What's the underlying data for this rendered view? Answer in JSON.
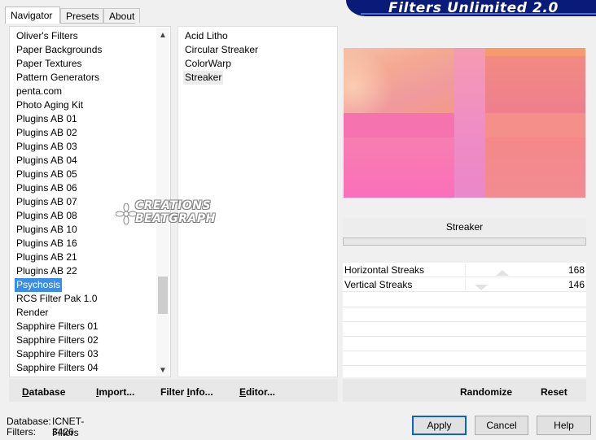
{
  "app": {
    "title": "Filters Unlimited 2.0"
  },
  "tabs": [
    {
      "label": "Navigator",
      "active": true
    },
    {
      "label": "Presets",
      "active": false
    },
    {
      "label": "About",
      "active": false
    }
  ],
  "categories": {
    "items": [
      "Oliver's Filters",
      "Paper Backgrounds",
      "Paper Textures",
      "Pattern Generators",
      "penta.com",
      "Photo Aging Kit",
      "Plugins AB 01",
      "Plugins AB 02",
      "Plugins AB 03",
      "Plugins AB 04",
      "Plugins AB 05",
      "Plugins AB 06",
      "Plugins AB 07",
      "Plugins AB 08",
      "Plugins AB 10",
      "Plugins AB 16",
      "Plugins AB 21",
      "Plugins AB 22",
      "Psychosis",
      "RCS Filter Pak 1.0",
      "Render",
      "Sapphire Filters 01",
      "Sapphire Filters 02",
      "Sapphire Filters 03",
      "Sapphire Filters 04"
    ],
    "selected": "Psychosis"
  },
  "filters": {
    "items": [
      "Acid Litho",
      "Circular Streaker",
      "ColorWarp",
      "Streaker"
    ],
    "selected": "Streaker"
  },
  "preview": {
    "filter_name": "Streaker"
  },
  "parameters": [
    {
      "label": "Horizontal Streaks",
      "value": "168"
    },
    {
      "label": "Vertical Streaks",
      "value": "146"
    }
  ],
  "toolbar": {
    "database": {
      "hot": "D",
      "rest": "atabase"
    },
    "import": {
      "hot": "I",
      "rest": "mport..."
    },
    "filter_info": {
      "pre": "Filter ",
      "hot": "I",
      "rest": "nfo..."
    },
    "editor": {
      "hot": "E",
      "rest": "ditor..."
    },
    "randomize": "Randomize",
    "reset": "Reset"
  },
  "status": {
    "database_label": "Database:",
    "database_value": "ICNET-Filters",
    "filters_label": "Filters:",
    "filters_value": "3426"
  },
  "buttons": {
    "apply": "Apply",
    "cancel": "Cancel",
    "help": "Help"
  },
  "watermark": {
    "line1": "CREATIONS",
    "line2": "BEATGRAPH"
  },
  "colors": {
    "selection": "#3a8ee6",
    "banner": "#0a1a78",
    "default_button_border": "#0a63c8"
  }
}
